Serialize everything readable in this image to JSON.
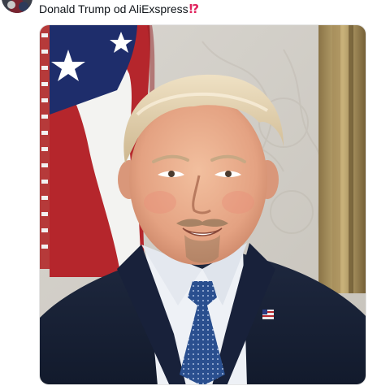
{
  "post": {
    "text": "Donald Trump od AliExspress",
    "emoji": "⁉",
    "emoji_color": "#e0245e",
    "avatar_icon": "user-avatar"
  },
  "media": {
    "type": "photo",
    "alt_icon": "portrait-photo"
  }
}
